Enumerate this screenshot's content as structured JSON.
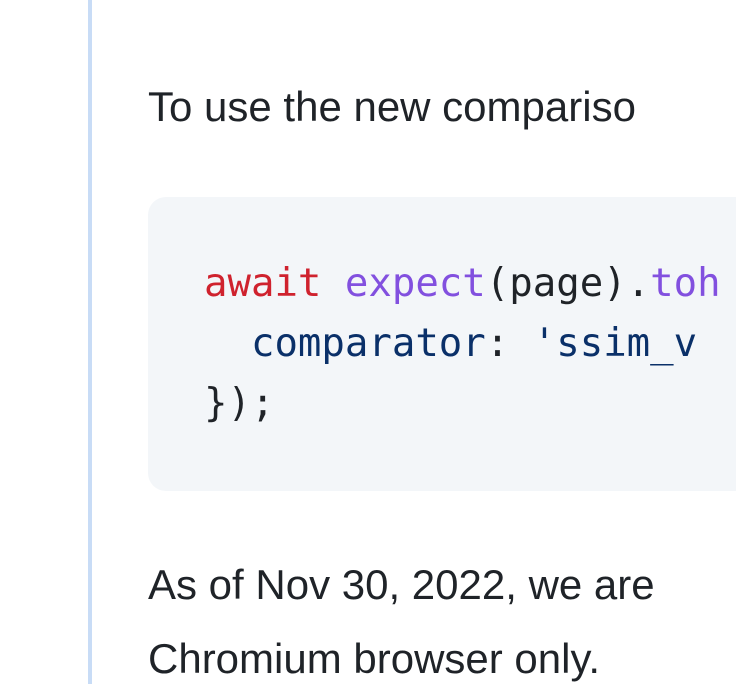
{
  "colors": {
    "text": "#1f2328",
    "quote_bar": "#c8dcf6",
    "code_background": "#f3f6f9",
    "keyword": "#cf222e",
    "function": "#8250df",
    "property": "#0a3069"
  },
  "content": {
    "intro_text": "To use the new compariso",
    "code": {
      "line1": {
        "keyword": "await",
        "space": " ",
        "func": "expect",
        "args": "(page).",
        "method": "toh"
      },
      "line2": {
        "indent": "  ",
        "prop": "comparator",
        "colon": ": ",
        "str": "'ssim_v"
      },
      "line3": {
        "close": "});"
      }
    },
    "note_line1": "As of Nov 30, 2022, we are",
    "note_line2": "Chromium browser only."
  }
}
